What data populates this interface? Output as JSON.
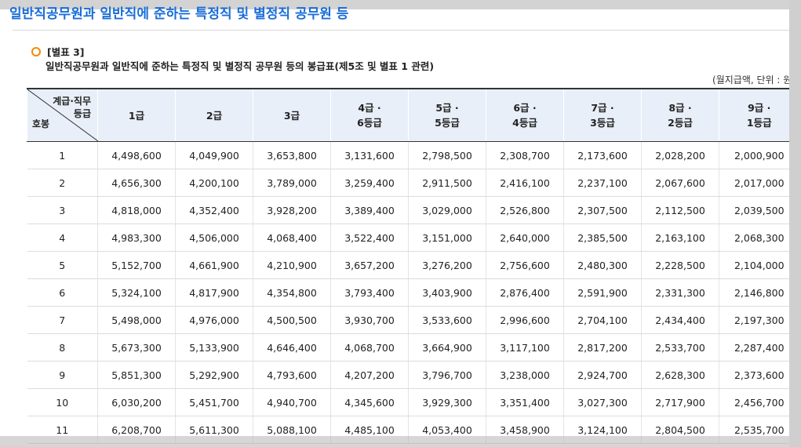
{
  "page": {
    "title": "일반직공무원과 일반직에 준하는 특정직 및 별정직 공무원 등",
    "section_label": "[별표 3]",
    "subtitle": "일반직공무원과 일반직에 준하는 특정직 및 별정직 공무원 등의 봉급표(제5조 및 별표 1 관련)",
    "unit": "(월지급액, 단위 : 원)"
  },
  "table": {
    "corner_top_line1": "계급·직무",
    "corner_top_line2": "등급",
    "corner_bottom": "호봉",
    "headers": [
      {
        "line1": "1급",
        "line2": ""
      },
      {
        "line1": "2급",
        "line2": ""
      },
      {
        "line1": "3급",
        "line2": ""
      },
      {
        "line1": "4급 ·",
        "line2": "6등급"
      },
      {
        "line1": "5급 ·",
        "line2": "5등급"
      },
      {
        "line1": "6급 ·",
        "line2": "4등급"
      },
      {
        "line1": "7급 ·",
        "line2": "3등급"
      },
      {
        "line1": "8급 ·",
        "line2": "2등급"
      },
      {
        "line1": "9급 ·",
        "line2": "1등급"
      }
    ],
    "rows": [
      {
        "step": "1",
        "values": [
          "4,498,600",
          "4,049,900",
          "3,653,800",
          "3,131,600",
          "2,798,500",
          "2,308,700",
          "2,173,600",
          "2,028,200",
          "2,000,900"
        ]
      },
      {
        "step": "2",
        "values": [
          "4,656,300",
          "4,200,100",
          "3,789,000",
          "3,259,400",
          "2,911,500",
          "2,416,100",
          "2,237,100",
          "2,067,600",
          "2,017,000"
        ]
      },
      {
        "step": "3",
        "values": [
          "4,818,000",
          "4,352,400",
          "3,928,200",
          "3,389,400",
          "3,029,000",
          "2,526,800",
          "2,307,500",
          "2,112,500",
          "2,039,500"
        ]
      },
      {
        "step": "4",
        "values": [
          "4,983,300",
          "4,506,000",
          "4,068,400",
          "3,522,400",
          "3,151,000",
          "2,640,000",
          "2,385,500",
          "2,163,100",
          "2,068,300"
        ]
      },
      {
        "step": "5",
        "values": [
          "5,152,700",
          "4,661,900",
          "4,210,900",
          "3,657,200",
          "3,276,200",
          "2,756,600",
          "2,480,300",
          "2,228,500",
          "2,104,000"
        ]
      },
      {
        "step": "6",
        "values": [
          "5,324,100",
          "4,817,900",
          "4,354,800",
          "3,793,400",
          "3,403,900",
          "2,876,400",
          "2,591,900",
          "2,331,300",
          "2,146,800"
        ]
      },
      {
        "step": "7",
        "values": [
          "5,498,000",
          "4,976,000",
          "4,500,500",
          "3,930,700",
          "3,533,600",
          "2,996,600",
          "2,704,100",
          "2,434,400",
          "2,197,300"
        ]
      },
      {
        "step": "8",
        "values": [
          "5,673,300",
          "5,133,900",
          "4,646,400",
          "4,068,700",
          "3,664,900",
          "3,117,100",
          "2,817,200",
          "2,533,700",
          "2,287,400"
        ]
      },
      {
        "step": "9",
        "values": [
          "5,851,300",
          "5,292,900",
          "4,793,600",
          "4,207,200",
          "3,796,700",
          "3,238,000",
          "2,924,700",
          "2,628,300",
          "2,373,600"
        ]
      },
      {
        "step": "10",
        "values": [
          "6,030,200",
          "5,451,700",
          "4,940,700",
          "4,345,600",
          "3,929,300",
          "3,351,400",
          "3,027,300",
          "2,717,900",
          "2,456,700"
        ]
      },
      {
        "step": "11",
        "values": [
          "6,208,700",
          "5,611,300",
          "5,088,100",
          "4,485,100",
          "4,053,400",
          "3,458,900",
          "3,124,100",
          "2,804,500",
          "2,535,700"
        ]
      }
    ]
  }
}
